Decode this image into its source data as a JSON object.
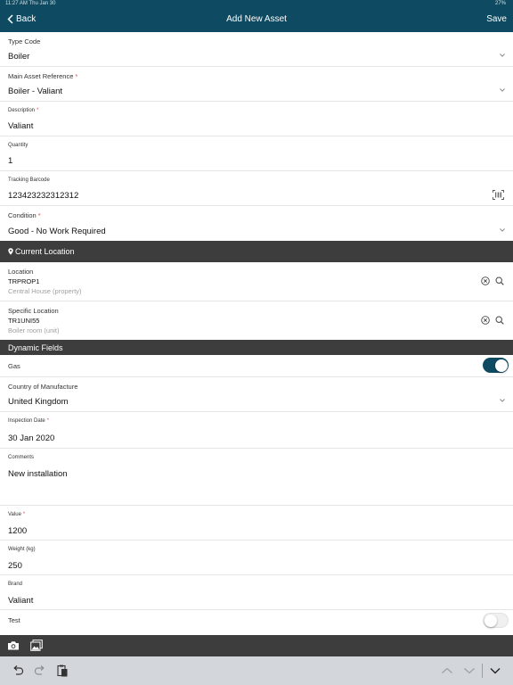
{
  "status_bar": {
    "time_date": "11:27 AM   Thu Jan 30",
    "battery": "27%"
  },
  "nav": {
    "back_label": "Back",
    "title": "Add New Asset",
    "save_label": "Save"
  },
  "fields": {
    "type_code": {
      "label": "Type Code",
      "value": "Boiler"
    },
    "main_asset": {
      "label": "Main Asset Reference",
      "value": "Boiler - Valiant"
    },
    "description": {
      "label": "Description",
      "value": "Valiant"
    },
    "quantity": {
      "label": "Quantity",
      "value": "1"
    },
    "tracking_barcode": {
      "label": "Tracking Barcode",
      "value": "123423232312312"
    },
    "condition": {
      "label": "Condition",
      "value": "Good - No Work Required"
    }
  },
  "current_location": {
    "header": "Current Location",
    "location": {
      "label": "Location",
      "code": "TRPROP1",
      "description": "Central House (property)"
    },
    "specific_location": {
      "label": "Specific Location",
      "code": "TR1UNI55",
      "description": "Boiler room (unit)"
    }
  },
  "dynamic_fields": {
    "header": "Dynamic Fields",
    "gas": {
      "label": "Gas",
      "on": true
    },
    "country": {
      "label": "Country of Manufacture",
      "value": "United Kingdom"
    },
    "inspection_date": {
      "label": "Inspection Date",
      "value": "30 Jan 2020"
    },
    "comments": {
      "label": "Comments",
      "value": "New installation"
    },
    "value": {
      "label": "Value",
      "value": "1200"
    },
    "weight": {
      "label": "Weight (kg)",
      "value": "250"
    },
    "brand": {
      "label": "Brand",
      "value": "Valiant"
    },
    "test": {
      "label": "Test",
      "on": false
    }
  },
  "required_marker": "*",
  "icons": {
    "back": "chevron-left-icon",
    "dropdown": "chevron-down-icon",
    "barcode": "barcode-icon",
    "location": "map-pin-icon",
    "clear": "clear-circle-icon",
    "search": "search-icon",
    "camera": "camera-icon",
    "gallery": "photo-gallery-icon",
    "undo": "undo-icon",
    "redo": "redo-icon",
    "paste": "paste-icon",
    "prev": "chevron-up-icon",
    "next": "chevron-down-icon",
    "dismiss": "keyboard-dismiss-icon"
  },
  "colors": {
    "accent": "#0e4a61",
    "section_bar": "#3d3d3d",
    "required": "#d9534f",
    "keyboard_bar": "#d3d6db"
  }
}
